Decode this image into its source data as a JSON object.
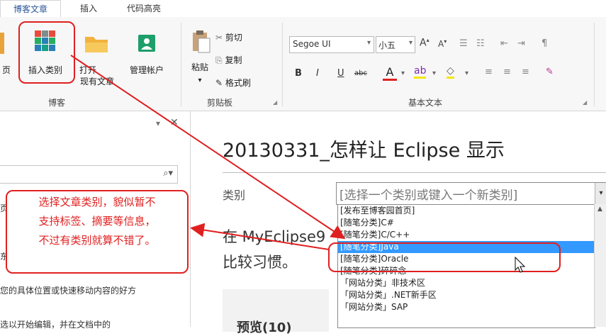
{
  "tabs": [
    {
      "label": "博客文章"
    },
    {
      "label": "插入"
    },
    {
      "label": "代码高亮"
    }
  ],
  "ribbon": {
    "blog_group": {
      "page_partial": "页",
      "insert_category": "插入类别",
      "open": "打开",
      "open_existing": "现有文章",
      "manage_accounts": "管理帐户",
      "group_label": "博客"
    },
    "clipboard": {
      "paste": "粘贴",
      "cut": "剪切",
      "copy": "复制",
      "format_painter": "格式刷",
      "group_label": "剪贴板"
    },
    "basic_text": {
      "font_name": "Segoe UI",
      "font_size": "小五",
      "bold": "B",
      "italic": "I",
      "underline": "U",
      "strike": "abc",
      "font_color_letter": "A",
      "group_label": "基本文本"
    }
  },
  "left_pane": {
    "pin": "▾",
    "close": "✕",
    "text_line1": "页",
    "text_line2": "东",
    "text_line3": "您的具体位置或快速移动内容的好方",
    "text_line4": "选以开始编辑，并在文档中的"
  },
  "document": {
    "title": "20130331_怎样让 Eclipse 显示",
    "category_label": "类别",
    "category_placeholder": "[选择一个类别或键入一个新类别]",
    "body_line1": "在 MyEclipse9",
    "body_line2": "比较习惯。",
    "preview_label": "预览(10)"
  },
  "category_options": [
    "[发布至博客园首页]",
    "[随笔分类]C#",
    "[随笔分类]C/C++",
    "[随笔分类]Java",
    "[随笔分类]Oracle",
    "[随笔分类]碎碎念",
    "「网站分类」非技术区",
    "「网站分类」.NET新手区",
    "「网站分类」SAP"
  ],
  "selected_option_index": 3,
  "annotation": {
    "line1": "选择文章类别，貌似暂不",
    "line2": "支持标签、摘要等信息，",
    "line3": "不过有类别就算不错了。"
  },
  "colors": {
    "accent": "#2b579a",
    "annotation_red": "#e02020",
    "selection_blue": "#3399ff"
  }
}
